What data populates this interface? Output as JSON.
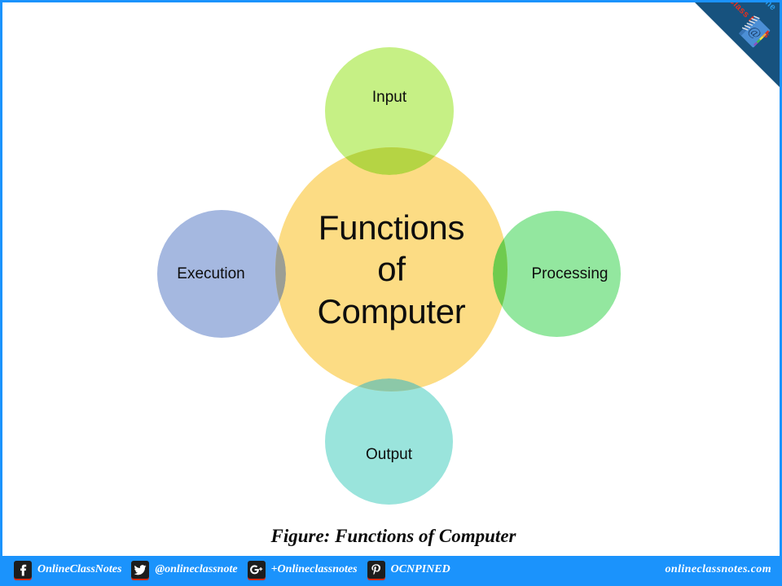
{
  "border_color": "#1B93FC",
  "caption": "Figure: Functions of Computer",
  "diagram": {
    "center": {
      "label_line1": "Functions",
      "label_line2": "of",
      "label_line3": "Computer",
      "color": "#FCDC84"
    },
    "satellites": [
      {
        "id": "input",
        "label": "Input",
        "color": "#C6F085",
        "position": "top"
      },
      {
        "id": "processing",
        "label": "Processing",
        "color": "#93E79F",
        "position": "right"
      },
      {
        "id": "output",
        "label": "Output",
        "color": "#9AE4DC",
        "position": "bottom"
      },
      {
        "id": "execution",
        "label": "Execution",
        "color": "#A5B8E0",
        "position": "left"
      }
    ],
    "overlap_colors": {
      "input": "#B5D444",
      "processing": "#6FCB4E",
      "output": "#8CC8A8",
      "execution": "#9B9E95"
    }
  },
  "corner_ribbon": {
    "line1": "Online",
    "line2": "Class Notes",
    "background": "#17527E",
    "line1_color": "#2B9BE8",
    "line2_color": "#E03020",
    "icon": "notebook-icon"
  },
  "social_bar": {
    "background": "#1B93FC",
    "items": [
      {
        "icon": "facebook-icon",
        "label": "OnlineClassNotes"
      },
      {
        "icon": "twitter-icon",
        "label": "@onlineclassnote"
      },
      {
        "icon": "googleplus-icon",
        "label": "+Onlineclassnotes"
      },
      {
        "icon": "pinterest-icon",
        "label": "OCNPINED"
      }
    ],
    "site_url": "onlineclassnotes.com"
  }
}
